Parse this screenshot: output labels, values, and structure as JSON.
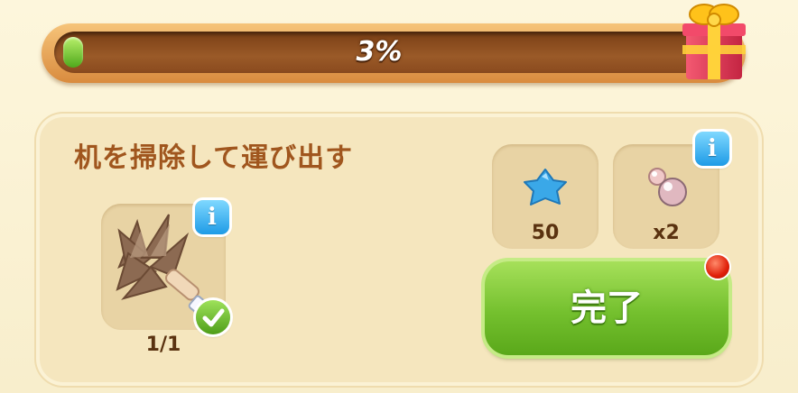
{
  "progress": {
    "label": "3%",
    "value": 0.03
  },
  "task": {
    "title": "机を掃除して運び出す"
  },
  "required_item": {
    "icon": "feather-duster-icon",
    "count": "1/1",
    "completed": true
  },
  "rewards": [
    {
      "icon": "blue-star-icon",
      "label": "50"
    },
    {
      "icon": "pearl-bead-icon",
      "label": "x2"
    }
  ],
  "info_icon_glyph": "i",
  "done_button": {
    "label": "完了"
  },
  "colors": {
    "accent_green": "#74c02e",
    "title_brown": "#a0561e",
    "info_blue": "#1e9be6",
    "notification_red": "#e0200a"
  }
}
